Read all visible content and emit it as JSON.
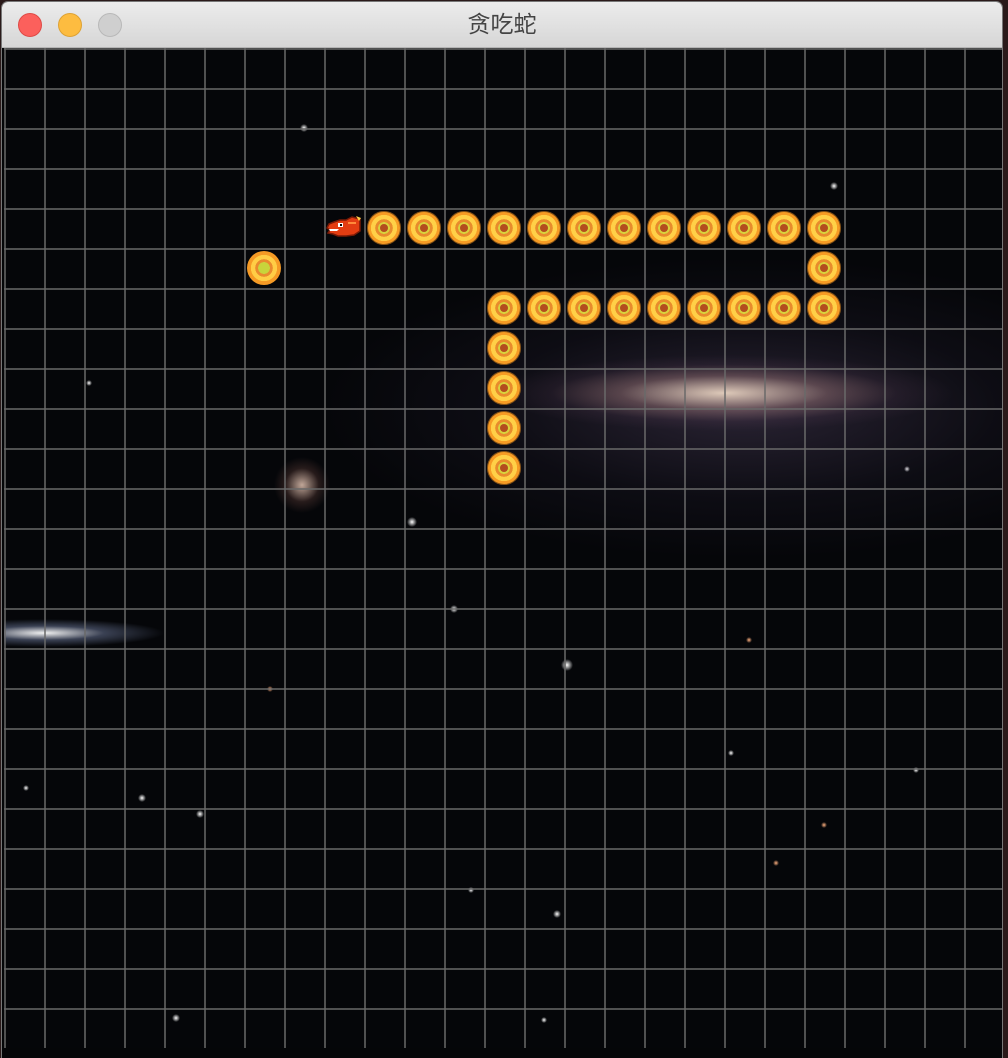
{
  "window": {
    "title": "贪吃蛇"
  },
  "board": {
    "columns": 25,
    "rows": 25,
    "grid": true,
    "background": "starfield-galaxy",
    "grid_color": "#696969"
  },
  "snake": {
    "direction": "left",
    "head_icon": "dragon-head-icon",
    "segment_icon": "orange-orb-icon",
    "head": [
      8,
      4
    ],
    "body": [
      [
        9,
        4
      ],
      [
        10,
        4
      ],
      [
        11,
        4
      ],
      [
        12,
        4
      ],
      [
        13,
        4
      ],
      [
        14,
        4
      ],
      [
        15,
        4
      ],
      [
        16,
        4
      ],
      [
        17,
        4
      ],
      [
        18,
        4
      ],
      [
        19,
        4
      ],
      [
        20,
        4
      ],
      [
        20,
        5
      ],
      [
        20,
        6
      ],
      [
        19,
        6
      ],
      [
        18,
        6
      ],
      [
        17,
        6
      ],
      [
        16,
        6
      ],
      [
        15,
        6
      ],
      [
        14,
        6
      ],
      [
        13,
        6
      ],
      [
        12,
        6
      ],
      [
        12,
        7
      ],
      [
        12,
        8
      ],
      [
        12,
        9
      ],
      [
        12,
        10
      ]
    ],
    "length": 28
  },
  "food": {
    "position": [
      6,
      5
    ],
    "icon": "food-orb-icon"
  },
  "colors": {
    "titlebar": "#e5e5e5",
    "close": "#fc605c",
    "minimize": "#fdbc40",
    "maximize": "#cfcfcf",
    "segment_outer": "#f69b24",
    "segment_inner": "#d8d43c",
    "head": "#e33d12"
  }
}
